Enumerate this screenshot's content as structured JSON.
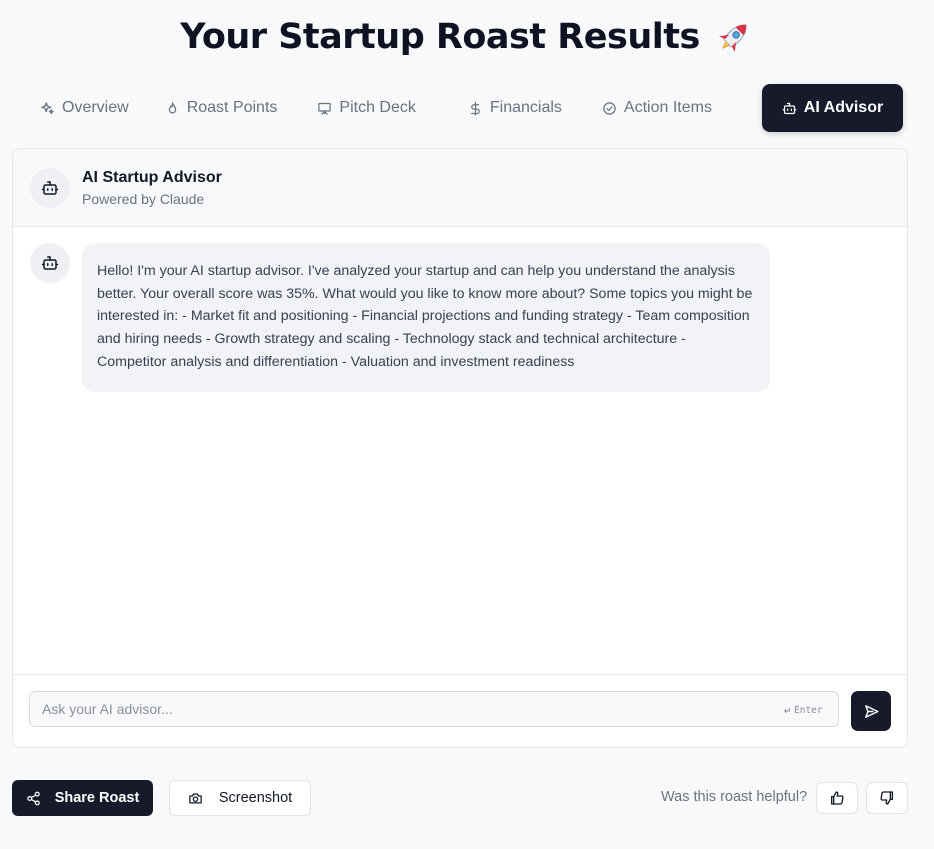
{
  "header": {
    "title": "Your Startup Roast Results",
    "title_icon": "rocket-icon"
  },
  "tabs": [
    {
      "label": "Overview",
      "icon": "sparkles-icon",
      "active": false
    },
    {
      "label": "Roast Points",
      "icon": "flame-icon",
      "active": false
    },
    {
      "label": "Pitch Deck",
      "icon": "presentation-icon",
      "active": false
    },
    {
      "label": "Financials",
      "icon": "dollar-icon",
      "active": false
    },
    {
      "label": "Action Items",
      "icon": "check-circle-icon",
      "active": false
    },
    {
      "label": "AI Advisor",
      "icon": "bot-icon",
      "active": true
    }
  ],
  "advisor": {
    "title": "AI Startup Advisor",
    "subtitle": "Powered by Claude",
    "messages": [
      {
        "sender": "assistant",
        "text": "Hello! I'm your AI startup advisor. I've analyzed your startup and can help you understand the analysis better. Your overall score was 35%. What would you like to know more about? Some topics you might be interested in: - Market fit and positioning - Financial projections and funding strategy - Team composition and hiring needs - Growth strategy and scaling - Technology stack and technical architecture - Competitor analysis and differentiation - Valuation and investment readiness"
      }
    ],
    "input": {
      "placeholder": "Ask your AI advisor...",
      "value": "",
      "hint": "Enter"
    }
  },
  "footer": {
    "share_label": "Share Roast",
    "screenshot_label": "Screenshot",
    "helpful_question": "Was this roast helpful?"
  },
  "colors": {
    "primary_dark": "#161a2b",
    "muted_text": "#6b7280",
    "bubble_bg": "#f1f3f7",
    "page_bg": "#f8f9fa"
  }
}
